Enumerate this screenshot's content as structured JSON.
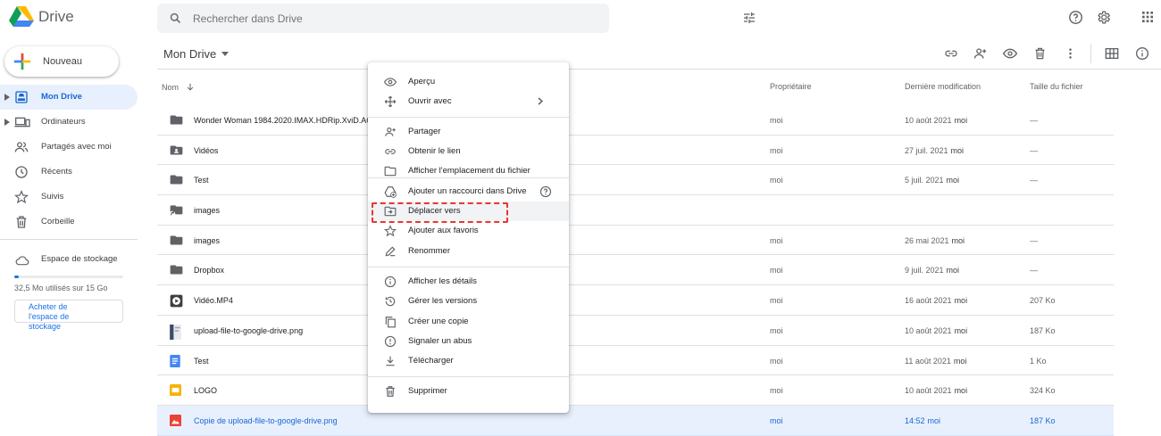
{
  "app": {
    "name": "Drive"
  },
  "search": {
    "placeholder": "Rechercher dans Drive"
  },
  "sidebar": {
    "new_label": "Nouveau",
    "items": [
      {
        "label": "Mon Drive",
        "icon": "my-drive-icon",
        "active": true
      },
      {
        "label": "Ordinateurs",
        "icon": "computers-icon",
        "active": false
      },
      {
        "label": "Partagés avec moi",
        "icon": "shared-icon",
        "active": false
      },
      {
        "label": "Récents",
        "icon": "clock-icon",
        "active": false
      },
      {
        "label": "Suivis",
        "icon": "star-icon",
        "active": false
      },
      {
        "label": "Corbeille",
        "icon": "trash-icon",
        "active": false
      }
    ],
    "storage_label": "Espace de stockage",
    "quota_text": "32,5 Mo utilisés sur 15 Go",
    "quota_fraction": 0.002,
    "buy_label": "Acheter de l'espace de stockage"
  },
  "main": {
    "breadcrumb": "Mon Drive",
    "columns": {
      "name": "Nom",
      "owner": "Propriétaire",
      "modified": "Dernière modification",
      "size": "Taille du fichier"
    },
    "files": [
      {
        "name": "Wonder Woman 1984.2020.IMAX.HDRip.XviD.AC",
        "type": "folder",
        "owner": "moi",
        "modified_date": "10 août 2021",
        "modified_by": "moi",
        "size": "—"
      },
      {
        "name": "Vidéos",
        "type": "shared-folder",
        "owner": "moi",
        "modified_date": "27 juil. 2021",
        "modified_by": "moi",
        "size": "—"
      },
      {
        "name": "Test",
        "type": "folder",
        "owner": "moi",
        "modified_date": "5 juil. 2021",
        "modified_by": "moi",
        "size": "—"
      },
      {
        "name": "images",
        "type": "shortcut",
        "owner": "",
        "modified_date": "",
        "modified_by": "",
        "size": ""
      },
      {
        "name": "images",
        "type": "folder",
        "owner": "moi",
        "modified_date": "26 mai 2021",
        "modified_by": "moi",
        "size": "—"
      },
      {
        "name": "Dropbox",
        "type": "folder",
        "owner": "moi",
        "modified_date": "9 juil. 2021",
        "modified_by": "moi",
        "size": "—"
      },
      {
        "name": "Vidéo.MP4",
        "type": "video",
        "owner": "moi",
        "modified_date": "16 août 2021",
        "modified_by": "moi",
        "size": "207 Ko"
      },
      {
        "name": "upload-file-to-google-drive.png",
        "type": "image-thumb",
        "owner": "moi",
        "modified_date": "10 août 2021",
        "modified_by": "moi",
        "size": "187 Ko"
      },
      {
        "name": "Test",
        "type": "doc",
        "owner": "moi",
        "modified_date": "11 août 2021",
        "modified_by": "moi",
        "size": "1 Ko"
      },
      {
        "name": "LOGO",
        "type": "slides",
        "owner": "moi",
        "modified_date": "10 août 2021",
        "modified_by": "moi",
        "size": "324 Ko"
      },
      {
        "name": "Copie de upload-file-to-google-drive.png",
        "type": "image",
        "owner": "moi",
        "modified_date": "14:52",
        "modified_by": "moi",
        "size": "187 Ko"
      }
    ]
  },
  "context_menu": {
    "items": [
      {
        "label": "Aperçu",
        "icon": "eye-icon"
      },
      {
        "label": "Ouvrir avec",
        "icon": "open-with-icon",
        "submenu": true
      },
      {
        "label": "Partager",
        "icon": "person-add-icon"
      },
      {
        "label": "Obtenir le lien",
        "icon": "link-icon"
      },
      {
        "label": "Afficher l'emplacement du fichier",
        "icon": "folder-outline-icon"
      },
      {
        "label": "Ajouter un raccourci dans Drive",
        "icon": "add-shortcut-icon",
        "help": true
      },
      {
        "label": "Déplacer vers",
        "icon": "move-icon",
        "highlighted": true
      },
      {
        "label": "Ajouter aux favoris",
        "icon": "star-icon"
      },
      {
        "label": "Renommer",
        "icon": "rename-icon"
      },
      {
        "label": "Afficher les détails",
        "icon": "info-icon"
      },
      {
        "label": "Gérer les versions",
        "icon": "history-icon"
      },
      {
        "label": "Créer une copie",
        "icon": "copy-icon"
      },
      {
        "label": "Signaler un abus",
        "icon": "report-icon"
      },
      {
        "label": "Télécharger",
        "icon": "download-icon"
      },
      {
        "label": "Supprimer",
        "icon": "trash-icon"
      }
    ]
  },
  "colors": {
    "accent": "#1a73e8",
    "selected_bg": "#e8f0fe",
    "highlight_border": "#e53935"
  }
}
